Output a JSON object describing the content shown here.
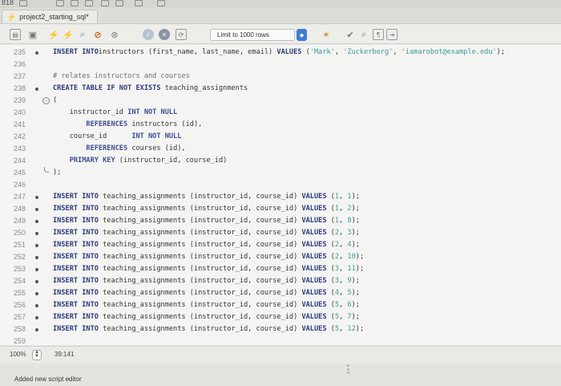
{
  "top_strip": {
    "label": "818"
  },
  "tab": {
    "title": "project2_starting_sql*"
  },
  "toolbar": {
    "limit_label": "Limit to 1000 rows",
    "limit_arrow": "◆"
  },
  "editor": {
    "lines": [
      {
        "n": "235",
        "dot": true,
        "fold": "",
        "parts": [
          [
            "kw",
            "INSERT INTO"
          ],
          [
            "",
            "instructors (first_name, last_name, email) "
          ],
          [
            "kw",
            "VALUES"
          ],
          [
            "",
            " ("
          ],
          [
            "str",
            "'Mark'"
          ],
          [
            "",
            ", "
          ],
          [
            "str",
            "'Zuckerberg'"
          ],
          [
            "",
            ", "
          ],
          [
            "str",
            "'iamarobot@example.edu'"
          ],
          [
            "",
            ");"
          ]
        ]
      },
      {
        "n": "236",
        "dot": false,
        "fold": "",
        "parts": []
      },
      {
        "n": "237",
        "dot": false,
        "fold": "",
        "parts": [
          [
            "cmt",
            "# relates instructors and courses"
          ]
        ]
      },
      {
        "n": "238",
        "dot": true,
        "fold": "",
        "parts": [
          [
            "kw",
            "CREATE TABLE IF NOT EXISTS"
          ],
          [
            "",
            " teaching_assignments"
          ]
        ]
      },
      {
        "n": "239",
        "dot": false,
        "fold": "open",
        "parts": [
          [
            "",
            "("
          ]
        ]
      },
      {
        "n": "240",
        "dot": false,
        "fold": "",
        "parts": [
          [
            "",
            "    instructor_id "
          ],
          [
            "kw2",
            "INT NOT NULL"
          ]
        ]
      },
      {
        "n": "241",
        "dot": false,
        "fold": "",
        "parts": [
          [
            "",
            "        "
          ],
          [
            "kw2",
            "REFERENCES"
          ],
          [
            "",
            " instructors (id),"
          ]
        ]
      },
      {
        "n": "242",
        "dot": false,
        "fold": "",
        "parts": [
          [
            "",
            "    course_id      "
          ],
          [
            "kw2",
            "INT NOT NULL"
          ]
        ]
      },
      {
        "n": "243",
        "dot": false,
        "fold": "",
        "parts": [
          [
            "",
            "        "
          ],
          [
            "kw2",
            "REFERENCES"
          ],
          [
            "",
            " courses (id),"
          ]
        ]
      },
      {
        "n": "244",
        "dot": false,
        "fold": "",
        "parts": [
          [
            "",
            "    "
          ],
          [
            "kw2",
            "PRIMARY KEY"
          ],
          [
            "",
            " (instructor_id, course_id)"
          ]
        ]
      },
      {
        "n": "245",
        "dot": false,
        "fold": "end",
        "parts": [
          [
            "",
            ");"
          ]
        ]
      },
      {
        "n": "246",
        "dot": false,
        "fold": "",
        "parts": []
      },
      {
        "n": "247",
        "dot": true,
        "fold": "",
        "parts": [
          [
            "kw",
            "INSERT INTO"
          ],
          [
            "",
            " teaching_assignments (instructor_id, course_id) "
          ],
          [
            "kw",
            "VALUES"
          ],
          [
            "",
            " ("
          ],
          [
            "num",
            "1"
          ],
          [
            "",
            ", "
          ],
          [
            "num",
            "1"
          ],
          [
            "",
            ");"
          ]
        ]
      },
      {
        "n": "248",
        "dot": true,
        "fold": "",
        "parts": [
          [
            "kw",
            "INSERT INTO"
          ],
          [
            "",
            " teaching_assignments (instructor_id, course_id) "
          ],
          [
            "kw",
            "VALUES"
          ],
          [
            "",
            " ("
          ],
          [
            "num",
            "1"
          ],
          [
            "",
            ", "
          ],
          [
            "num",
            "2"
          ],
          [
            "",
            ");"
          ]
        ]
      },
      {
        "n": "249",
        "dot": true,
        "fold": "",
        "parts": [
          [
            "kw",
            "INSERT INTO"
          ],
          [
            "",
            " teaching_assignments (instructor_id, course_id) "
          ],
          [
            "kw",
            "VALUES"
          ],
          [
            "",
            " ("
          ],
          [
            "num",
            "1"
          ],
          [
            "",
            ", "
          ],
          [
            "num",
            "8"
          ],
          [
            "",
            ");"
          ]
        ]
      },
      {
        "n": "250",
        "dot": true,
        "fold": "",
        "parts": [
          [
            "kw",
            "INSERT INTO"
          ],
          [
            "",
            " teaching_assignments (instructor_id, course_id) "
          ],
          [
            "kw",
            "VALUES"
          ],
          [
            "",
            " ("
          ],
          [
            "num",
            "2"
          ],
          [
            "",
            ", "
          ],
          [
            "num",
            "3"
          ],
          [
            "",
            ");"
          ]
        ]
      },
      {
        "n": "251",
        "dot": true,
        "fold": "",
        "parts": [
          [
            "kw",
            "INSERT INTO"
          ],
          [
            "",
            " teaching_assignments (instructor_id, course_id) "
          ],
          [
            "kw",
            "VALUES"
          ],
          [
            "",
            " ("
          ],
          [
            "num",
            "2"
          ],
          [
            "",
            ", "
          ],
          [
            "num",
            "4"
          ],
          [
            "",
            ");"
          ]
        ]
      },
      {
        "n": "252",
        "dot": true,
        "fold": "",
        "parts": [
          [
            "kw",
            "INSERT INTO"
          ],
          [
            "",
            " teaching_assignments (instructor_id, course_id) "
          ],
          [
            "kw",
            "VALUES"
          ],
          [
            "",
            " ("
          ],
          [
            "num",
            "2"
          ],
          [
            "",
            ", "
          ],
          [
            "num",
            "10"
          ],
          [
            "",
            ");"
          ]
        ]
      },
      {
        "n": "253",
        "dot": true,
        "fold": "",
        "parts": [
          [
            "kw",
            "INSERT INTO"
          ],
          [
            "",
            " teaching_assignments (instructor_id, course_id) "
          ],
          [
            "kw",
            "VALUES"
          ],
          [
            "",
            " ("
          ],
          [
            "num",
            "3"
          ],
          [
            "",
            ", "
          ],
          [
            "num",
            "11"
          ],
          [
            "",
            ");"
          ]
        ]
      },
      {
        "n": "254",
        "dot": true,
        "fold": "",
        "parts": [
          [
            "kw",
            "INSERT INTO"
          ],
          [
            "",
            " teaching_assignments (instructor_id, course_id) "
          ],
          [
            "kw",
            "VALUES"
          ],
          [
            "",
            " ("
          ],
          [
            "num",
            "3"
          ],
          [
            "",
            ", "
          ],
          [
            "num",
            "9"
          ],
          [
            "",
            ");"
          ]
        ]
      },
      {
        "n": "255",
        "dot": true,
        "fold": "",
        "parts": [
          [
            "kw",
            "INSERT INTO"
          ],
          [
            "",
            " teaching_assignments (instructor_id, course_id) "
          ],
          [
            "kw",
            "VALUES"
          ],
          [
            "",
            " ("
          ],
          [
            "num",
            "4"
          ],
          [
            "",
            ", "
          ],
          [
            "num",
            "5"
          ],
          [
            "",
            ");"
          ]
        ]
      },
      {
        "n": "256",
        "dot": true,
        "fold": "",
        "parts": [
          [
            "kw",
            "INSERT INTO"
          ],
          [
            "",
            " teaching_assignments (instructor_id, course_id) "
          ],
          [
            "kw",
            "VALUES"
          ],
          [
            "",
            " ("
          ],
          [
            "num",
            "5"
          ],
          [
            "",
            ", "
          ],
          [
            "num",
            "6"
          ],
          [
            "",
            ");"
          ]
        ]
      },
      {
        "n": "257",
        "dot": true,
        "fold": "",
        "parts": [
          [
            "kw",
            "INSERT INTO"
          ],
          [
            "",
            " teaching_assignments (instructor_id, course_id) "
          ],
          [
            "kw",
            "VALUES"
          ],
          [
            "",
            " ("
          ],
          [
            "num",
            "5"
          ],
          [
            "",
            ", "
          ],
          [
            "num",
            "7"
          ],
          [
            "",
            ");"
          ]
        ]
      },
      {
        "n": "258",
        "dot": true,
        "fold": "",
        "parts": [
          [
            "kw",
            "INSERT INTO"
          ],
          [
            "",
            " teaching_assignments (instructor_id, course_id) "
          ],
          [
            "kw",
            "VALUES"
          ],
          [
            "",
            " ("
          ],
          [
            "num",
            "5"
          ],
          [
            "",
            ", "
          ],
          [
            "num",
            "12"
          ],
          [
            "",
            ");"
          ]
        ]
      },
      {
        "n": "259",
        "dot": false,
        "fold": "",
        "parts": []
      }
    ]
  },
  "status": {
    "zoom": "100%",
    "cursor_position": "39:141"
  },
  "output": {
    "message": "Added new script editor"
  }
}
